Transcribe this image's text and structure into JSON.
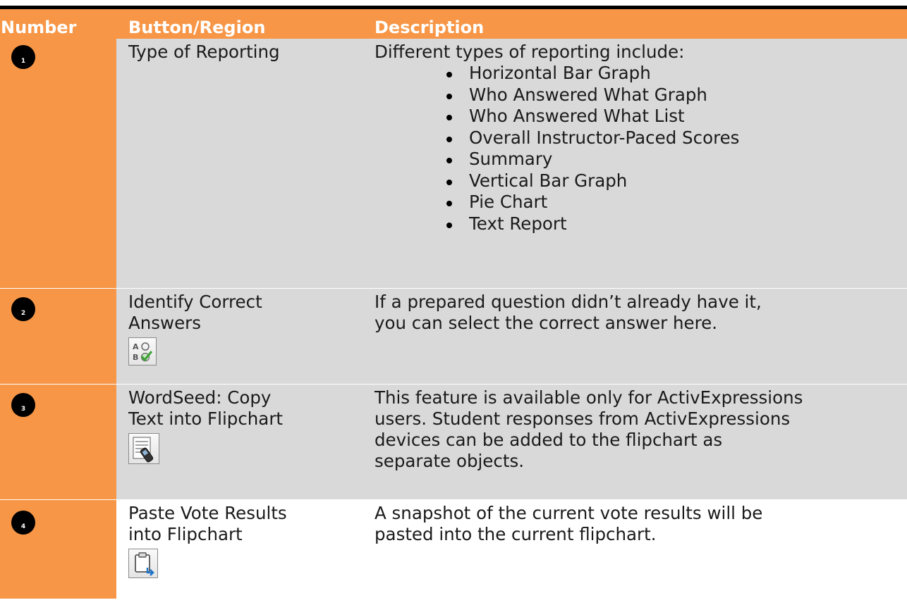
{
  "table": {
    "headers": {
      "number": "Number",
      "region": "Button/Region",
      "description": "Description"
    },
    "rows": [
      {
        "number": "1",
        "region": "Type of Reporting",
        "description": "Different types of reporting include:",
        "bullets": [
          "Horizontal Bar Graph",
          "Who Answered What Graph",
          "Who Answered What List",
          "Overall Instructor-Paced Scores",
          "Summary",
          "Vertical Bar Graph",
          "Pie Chart",
          "Text Report"
        ],
        "icon": null
      },
      {
        "number": "2",
        "region": "Identify Correct\nAnswers",
        "description": "If a prepared question didn’t already have it,\nyou can select the correct answer here.",
        "icon": "identify-correct-answers-icon"
      },
      {
        "number": "3",
        "region": "WordSeed: Copy\nText into Flipchart",
        "description": "This feature is available only for ActivExpressions\nusers. Student responses from ActivExpressions\ndevices can be added to the flipchart as\nseparate objects.",
        "icon": "wordseed-copy-text-icon"
      },
      {
        "number": "4",
        "region": "Paste Vote Results\ninto Flipchart",
        "description": "A snapshot of the current vote results will be\npasted into the current flipchart.",
        "icon": "paste-vote-results-icon"
      }
    ]
  },
  "colors": {
    "header_bg": "#f79646",
    "number_col_bg": "#f79646",
    "body_bg": "#d9d9d9",
    "header_text": "#ffffff",
    "bubble": "#000000",
    "check_green": "#3aa335"
  }
}
